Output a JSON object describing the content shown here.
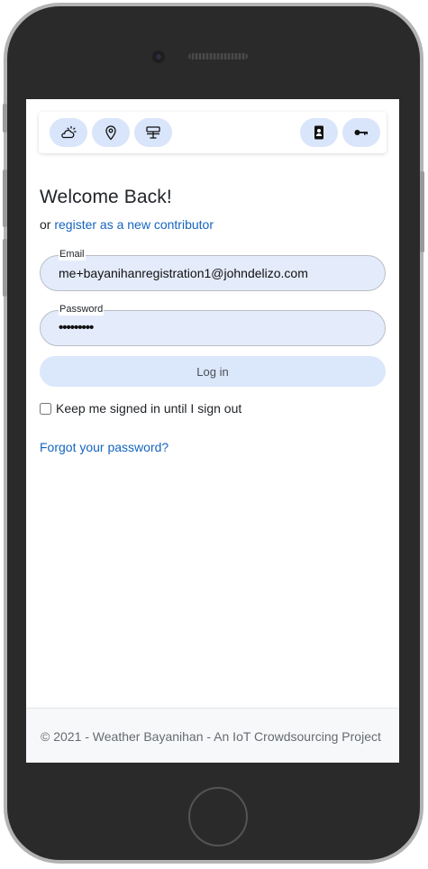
{
  "nav": {
    "left_icons": [
      "cloud-sun-icon",
      "map-pin-icon",
      "weather-station-icon"
    ],
    "right_icons": [
      "contact-card-icon",
      "key-icon"
    ]
  },
  "login": {
    "title": "Welcome Back!",
    "subtitle_prefix": "or ",
    "register_link": "register as a new contributor",
    "email_label": "Email",
    "email_value": "me+bayanihanregistration1@johndelizo.com",
    "password_label": "Password",
    "password_value": "•••••••••",
    "login_button": "Log in",
    "keep_signed_in": "Keep me signed in until I sign out",
    "forgot_password": "Forgot your password?"
  },
  "footer": {
    "text": "© 2021 - Weather Bayanihan - An IoT Crowdsourcing Project"
  },
  "colors": {
    "accent": "#1565c0",
    "input_bg": "#e4ecfb",
    "button_bg": "#dbe7fb",
    "phone_body": "#2a2a2a"
  }
}
